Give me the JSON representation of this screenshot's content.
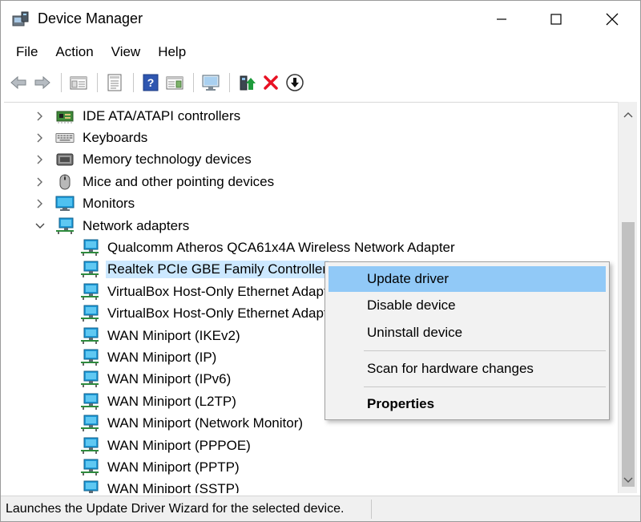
{
  "window": {
    "title": "Device Manager"
  },
  "menubar": {
    "items": [
      "File",
      "Action",
      "View",
      "Help"
    ]
  },
  "toolbar": {
    "icons": [
      "back-icon",
      "forward-icon",
      "show-hide-tree-icon",
      "properties-icon",
      "help-icon",
      "action-pane-icon",
      "monitor-icon",
      "update-driver-icon",
      "uninstall-icon",
      "disable-icon"
    ]
  },
  "tree": {
    "rows": [
      {
        "label": "IDE ATA/ATAPI controllers",
        "expanded": false,
        "icon": "ide-controller-icon"
      },
      {
        "label": "Keyboards",
        "expanded": false,
        "icon": "keyboard-icon"
      },
      {
        "label": "Memory technology devices",
        "expanded": false,
        "icon": "memory-icon"
      },
      {
        "label": "Mice and other pointing devices",
        "expanded": false,
        "icon": "mouse-icon"
      },
      {
        "label": "Monitors",
        "expanded": false,
        "icon": "monitor-icon"
      },
      {
        "label": "Network adapters",
        "expanded": true,
        "icon": "network-adapter-icon"
      },
      {
        "label": "Qualcomm Atheros QCA61x4A Wireless Network Adapter",
        "icon": "network-adapter-icon"
      },
      {
        "label": "Realtek PCIe GBE Family Controller",
        "icon": "network-adapter-icon",
        "selected": true
      },
      {
        "label": "VirtualBox Host-Only Ethernet Adapter",
        "icon": "network-adapter-icon"
      },
      {
        "label": "VirtualBox Host-Only Ethernet Adapter",
        "icon": "network-adapter-icon"
      },
      {
        "label": "WAN Miniport (IKEv2)",
        "icon": "network-adapter-icon"
      },
      {
        "label": "WAN Miniport (IP)",
        "icon": "network-adapter-icon"
      },
      {
        "label": "WAN Miniport (IPv6)",
        "icon": "network-adapter-icon"
      },
      {
        "label": "WAN Miniport (L2TP)",
        "icon": "network-adapter-icon"
      },
      {
        "label": "WAN Miniport (Network Monitor)",
        "icon": "network-adapter-icon"
      },
      {
        "label": "WAN Miniport (PPPOE)",
        "icon": "network-adapter-icon"
      },
      {
        "label": "WAN Miniport (PPTP)",
        "icon": "network-adapter-icon"
      },
      {
        "label": "WAN Miniport (SSTP)",
        "icon": "network-adapter-icon"
      }
    ]
  },
  "context_menu": {
    "items": [
      {
        "label": "Update driver",
        "highlighted": true
      },
      {
        "label": "Disable device"
      },
      {
        "label": "Uninstall device"
      },
      {
        "label": "Scan for hardware changes"
      },
      {
        "label": "Properties",
        "bold": true
      }
    ]
  },
  "statusbar": {
    "text": "Launches the Update Driver Wizard for the selected device."
  },
  "colors": {
    "selection": "#cce8ff",
    "menu_highlight": "#91c9f7",
    "uninstall_red": "#e81123",
    "update_green": "#1e9b3c"
  }
}
